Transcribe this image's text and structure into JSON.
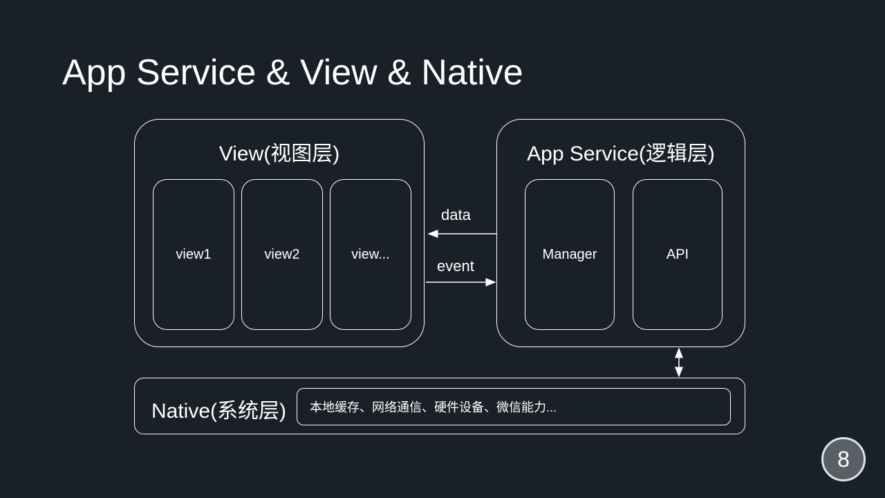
{
  "title": "App Service & View & Native",
  "view": {
    "label": "View(视图层)",
    "items": [
      "view1",
      "view2",
      "view..."
    ]
  },
  "appService": {
    "label": "App Service(逻辑层)",
    "items": [
      "Manager",
      "API"
    ]
  },
  "arrows": {
    "data": "data",
    "event": "event"
  },
  "native": {
    "label": "Native(系统层)",
    "content": "本地缓存、网络通信、硬件设备、微信能力..."
  },
  "pageNumber": "8"
}
